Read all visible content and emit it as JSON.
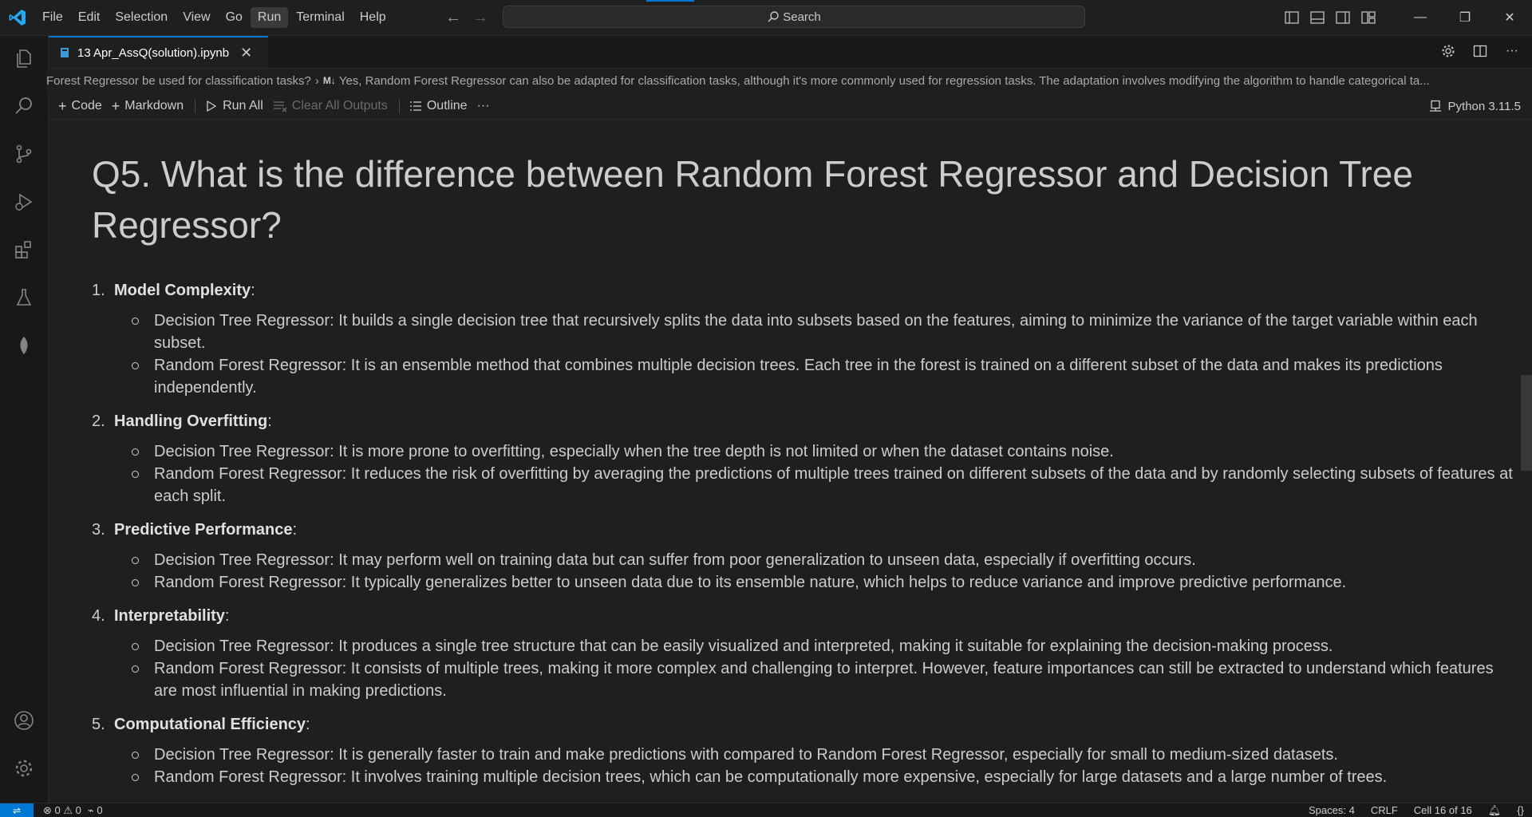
{
  "menu": {
    "items": [
      "File",
      "Edit",
      "Selection",
      "View",
      "Go",
      "Run",
      "Terminal",
      "Help"
    ],
    "active": "Run"
  },
  "search": {
    "label": "Search"
  },
  "tab": {
    "title": "13 Apr_AssQ(solution).ipynb",
    "close": "✕"
  },
  "breadcrumb": {
    "part1": "Forest Regressor be used for classification tasks?",
    "part2": "Yes, Random Forest Regressor can also be adapted for classification tasks, although it's more commonly used for regression tasks. The adaptation involves modifying the algorithm to handle categorical ta...",
    "badge": "M↓"
  },
  "toolbar": {
    "code": "Code",
    "markdown": "Markdown",
    "run_all": "Run All",
    "clear_outputs": "Clear All Outputs",
    "outline": "Outline",
    "more": "···",
    "kernel": "Python 3.11.5"
  },
  "cell": {
    "title": "Q5. What is the difference between Random Forest Regressor and Decision Tree Regressor?",
    "sections": [
      {
        "num": "1.",
        "heading": "Model Complexity",
        "bullets": [
          "Decision Tree Regressor: It builds a single decision tree that recursively splits the data into subsets based on the features, aiming to minimize the variance of the target variable within each subset.",
          "Random Forest Regressor: It is an ensemble method that combines multiple decision trees. Each tree in the forest is trained on a different subset of the data and makes its predictions independently."
        ]
      },
      {
        "num": "2.",
        "heading": "Handling Overfitting",
        "bullets": [
          "Decision Tree Regressor: It is more prone to overfitting, especially when the tree depth is not limited or when the dataset contains noise.",
          "Random Forest Regressor: It reduces the risk of overfitting by averaging the predictions of multiple trees trained on different subsets of the data and by randomly selecting subsets of features at each split."
        ]
      },
      {
        "num": "3.",
        "heading": "Predictive Performance",
        "bullets": [
          "Decision Tree Regressor: It may perform well on training data but can suffer from poor generalization to unseen data, especially if overfitting occurs.",
          "Random Forest Regressor: It typically generalizes better to unseen data due to its ensemble nature, which helps to reduce variance and improve predictive performance."
        ]
      },
      {
        "num": "4.",
        "heading": "Interpretability",
        "bullets": [
          "Decision Tree Regressor: It produces a single tree structure that can be easily visualized and interpreted, making it suitable for explaining the decision-making process.",
          "Random Forest Regressor: It consists of multiple trees, making it more complex and challenging to interpret. However, feature importances can still be extracted to understand which features are most influential in making predictions."
        ]
      },
      {
        "num": "5.",
        "heading": "Computational Efficiency",
        "bullets": [
          "Decision Tree Regressor: It is generally faster to train and make predictions with compared to Random Forest Regressor, especially for small to medium-sized datasets.",
          "Random Forest Regressor: It involves training multiple decision trees, which can be computationally more expensive, especially for large datasets and a large number of trees."
        ]
      }
    ]
  },
  "status": {
    "errors": "0",
    "warnings": "0",
    "ports": "0",
    "spaces": "Spaces: 4",
    "eol": "CRLF",
    "cell": "Cell 16 of 16"
  },
  "colors": {
    "accent": "#0078d4",
    "background": "#1f1f1f",
    "sidebar": "#181818"
  }
}
